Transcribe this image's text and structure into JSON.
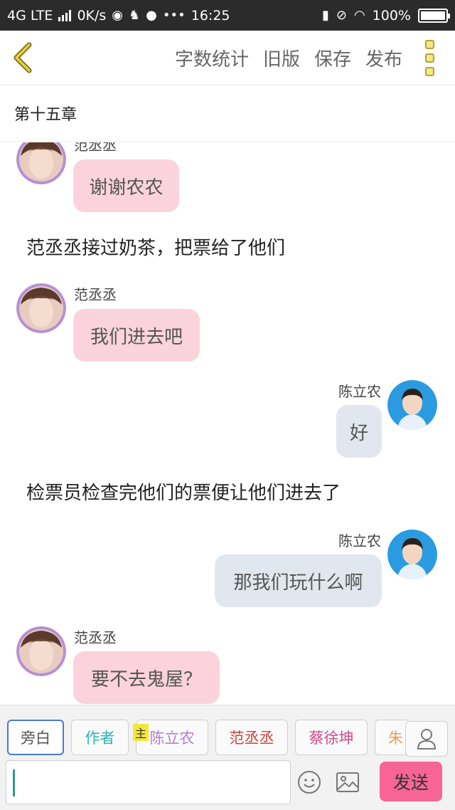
{
  "status_bar": {
    "network": "4G LTE",
    "speed": "0K/s",
    "time": "16:25",
    "battery": "100%",
    "more": "•••"
  },
  "top_bar": {
    "actions": [
      "字数统计",
      "旧版",
      "保存",
      "发布"
    ]
  },
  "chapter": {
    "title": "第十五章"
  },
  "chat": {
    "messages": [
      {
        "type": "left",
        "name": "范丞丞",
        "text": "谢谢农农"
      },
      {
        "type": "narration",
        "text": "范丞丞接过奶茶，把票给了他们"
      },
      {
        "type": "left",
        "name": "范丞丞",
        "text": "我们进去吧"
      },
      {
        "type": "right",
        "name": "陈立农",
        "text": "好"
      },
      {
        "type": "narration",
        "text": "检票员检查完他们的票便让他们进去了"
      },
      {
        "type": "right",
        "name": "陈立农",
        "text": "那我们玩什么啊"
      },
      {
        "type": "left",
        "name": "范丞丞",
        "text": "要不去鬼屋？"
      }
    ]
  },
  "bottom": {
    "roles": [
      {
        "label": "旁白",
        "color": "#555555"
      },
      {
        "label": "作者",
        "color": "#2bb5b0"
      },
      {
        "label": "陈立农",
        "color": "#b57cd8"
      },
      {
        "label": "范丞丞",
        "color": "#d0413a"
      },
      {
        "label": "蔡徐坤",
        "color": "#d04a8a"
      },
      {
        "label": "朱",
        "color": "#e8a050"
      }
    ],
    "main_badge": "主",
    "input_value": "",
    "send_label": "发送"
  },
  "colors": {
    "pink_bubble": "#fbd3dc",
    "blue_bubble": "#e0e7ef",
    "send_button": "#f76597",
    "back_arrow": "#c9b840"
  }
}
